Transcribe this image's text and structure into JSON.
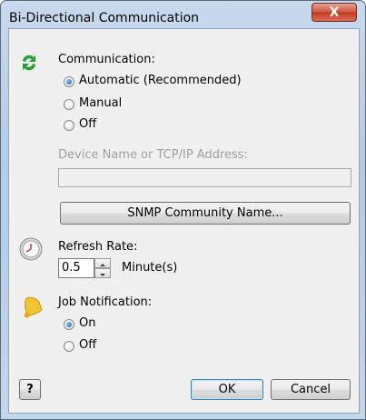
{
  "window": {
    "title": "Bi-Directional Communication",
    "close_glyph": "X"
  },
  "communication": {
    "label": "Communication:",
    "icon": "refresh-arrows-icon",
    "options": [
      "Automatic (Recommended)",
      "Manual",
      "Off"
    ],
    "selected": "Automatic (Recommended)",
    "device_label": "Device Name or TCP/IP Address:",
    "device_value": "",
    "snmp_button": "SNMP Community Name..."
  },
  "refresh": {
    "label": "Refresh Rate:",
    "icon": "clock-icon",
    "value": "0.5",
    "unit": "Minute(s)"
  },
  "job": {
    "label": "Job Notification:",
    "icon": "bell-icon",
    "options": [
      "On",
      "Off"
    ],
    "selected": "On"
  },
  "footer": {
    "help": "?",
    "ok": "OK",
    "cancel": "Cancel"
  },
  "colors": {
    "title_bar": "#b4cbe4",
    "close_button": "#c33a22",
    "dialog_bg": "#f0f0f0",
    "disabled_text": "#a0a0a0",
    "comm_icon": "#2e9b3a",
    "bell_icon": "#f1c232"
  }
}
